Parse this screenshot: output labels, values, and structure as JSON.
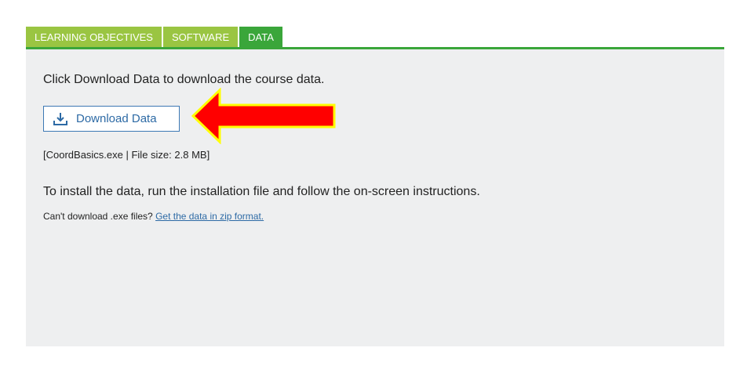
{
  "tabs": [
    {
      "label": "LEARNING OBJECTIVES",
      "active": false
    },
    {
      "label": "SOFTWARE",
      "active": false
    },
    {
      "label": "DATA",
      "active": true
    }
  ],
  "panel": {
    "intro": "Click Download Data to download the course data.",
    "download_button": {
      "label": "Download Data",
      "icon": "download-icon"
    },
    "file_info": "[CoordBasics.exe | File size: 2.8 MB]",
    "install_text": "To install the data, run the installation file and follow the on-screen instructions.",
    "zip_prompt": "Can't download .exe files?",
    "zip_link": "Get the data in zip format."
  },
  "annotation": {
    "arrow_color": "#ff0000",
    "arrow_outline": "#ffff00"
  },
  "colors": {
    "tab_inactive": "#9ac542",
    "tab_active": "#3aa63a",
    "panel_bg": "#eeeff0",
    "link": "#2d6aa5"
  }
}
